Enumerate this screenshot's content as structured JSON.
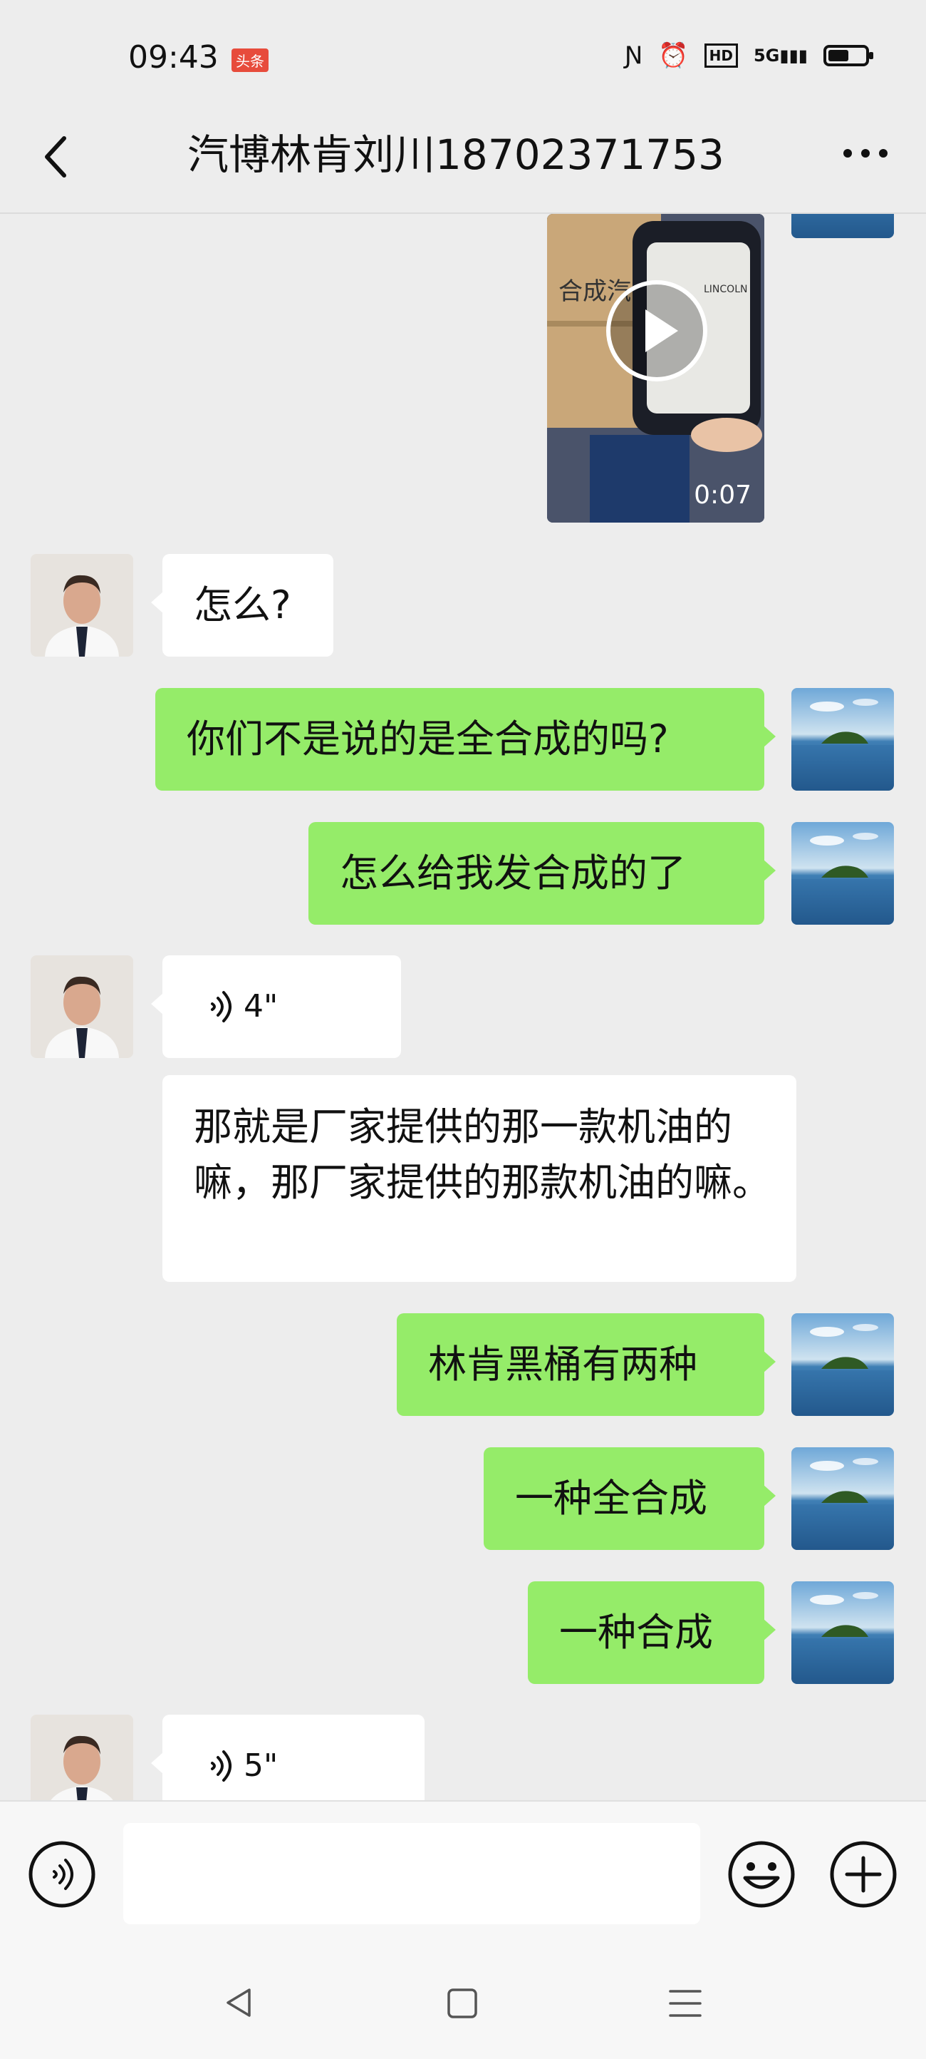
{
  "status": {
    "time": "09:43",
    "news_badge": "头条",
    "hd": "HD",
    "network": "5G"
  },
  "header": {
    "title": "汽博林肯刘川18702371753"
  },
  "video": {
    "duration": "0:07",
    "box_label": "合成汽",
    "brand": "LINCOLN"
  },
  "messages": [
    {
      "side": "left",
      "type": "text",
      "text": "怎么?"
    },
    {
      "side": "right",
      "type": "text",
      "text": "你们不是说的是全合成的吗?"
    },
    {
      "side": "right",
      "type": "text",
      "text": "怎么给我发合成的了"
    },
    {
      "side": "left",
      "type": "voice",
      "duration": "4\""
    },
    {
      "side": "left",
      "type": "text",
      "text": "那就是厂家提供的那一款机油的嘛，那厂家提供的那款机油的嘛。"
    },
    {
      "side": "right",
      "type": "text",
      "text": "林肯黑桶有两种"
    },
    {
      "side": "right",
      "type": "text",
      "text": "一种全合成"
    },
    {
      "side": "right",
      "type": "text",
      "text": "一种合成"
    },
    {
      "side": "left",
      "type": "voice",
      "duration": "5\""
    }
  ],
  "input": {
    "voice_icon": "voice-mode-icon",
    "emoji_icon": "emoji-icon",
    "plus_icon": "plus-icon",
    "value": ""
  },
  "colors": {
    "sent_bubble": "#95ec69",
    "received_bubble": "#ffffff",
    "background": "#ededed"
  }
}
